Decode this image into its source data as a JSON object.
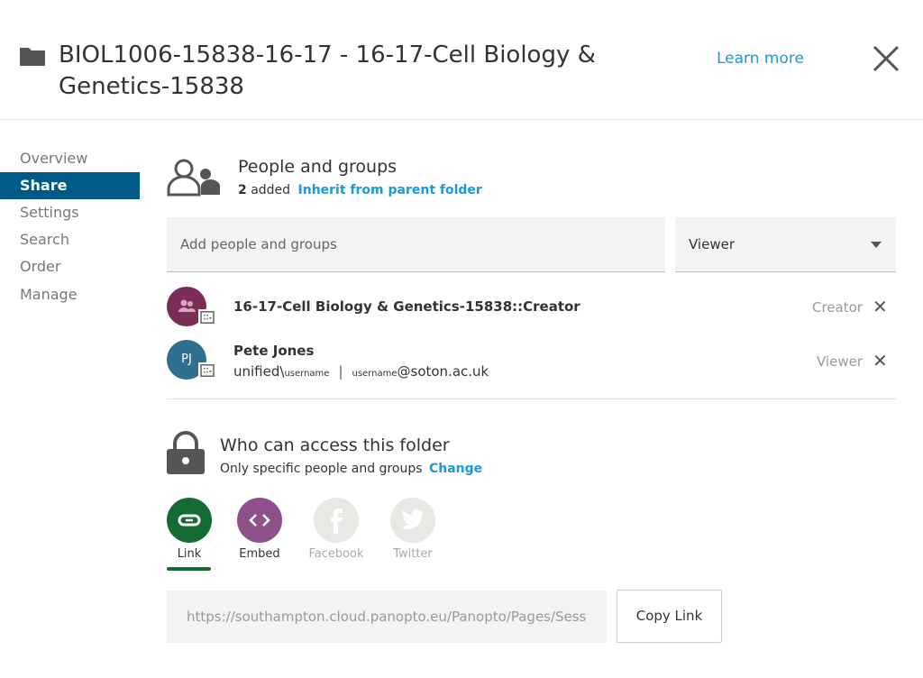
{
  "header": {
    "title": "BIOL1006-15838-16-17 - 16-17-Cell Biology & Genetics-15838",
    "learn_more": "Learn more",
    "icon": "folder-icon"
  },
  "sidebar": {
    "items": [
      {
        "label": "Overview"
      },
      {
        "label": "Share",
        "active": true
      },
      {
        "label": "Settings"
      },
      {
        "label": "Search"
      },
      {
        "label": "Order"
      },
      {
        "label": "Manage"
      }
    ]
  },
  "people": {
    "title": "People and groups",
    "count": "2",
    "added": "added",
    "inherit": "Inherit from parent folder",
    "placeholder": "Add people and groups",
    "role_select": "Viewer",
    "entries": [
      {
        "name": "16-17-Cell Biology & Genetics-15838::Creator",
        "role": "Creator",
        "avatar_color": "#7a2d55"
      },
      {
        "name": "Pete Jones",
        "initials": "PJ",
        "domain": "unified\\",
        "user1": "username",
        "sep": "|",
        "user2": "username",
        "email": "@soton.ac.uk",
        "role": "Viewer",
        "avatar_color": "#2f6f8f"
      }
    ]
  },
  "access": {
    "title": "Who can access this folder",
    "desc": "Only specific people and groups",
    "change": "Change"
  },
  "share": {
    "options": [
      {
        "label": "Link",
        "color": "#156b34"
      },
      {
        "label": "Embed",
        "color": "#8f5189"
      },
      {
        "label": "Facebook",
        "color": "#e8e8e4"
      },
      {
        "label": "Twitter",
        "color": "#e8e8e4"
      }
    ],
    "url": "https://southampton.cloud.panopto.eu/Panopto/Pages/Sess",
    "copy": "Copy Link"
  }
}
